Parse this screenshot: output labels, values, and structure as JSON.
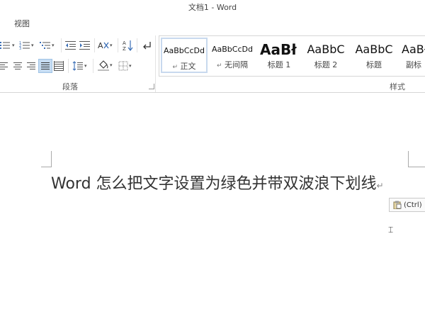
{
  "window": {
    "title": "文档1 - Word"
  },
  "tabs": {
    "view_label": "视图"
  },
  "ribbon": {
    "paragraph_group_label": "段落",
    "styles_group_label": "样式",
    "styles": [
      {
        "preview": "AaBbCcDd",
        "name": "正文",
        "mark": "↵",
        "active": true
      },
      {
        "preview": "AaBbCcDd",
        "name": "无间隔",
        "mark": "↵",
        "active": false
      },
      {
        "preview": "AaBł",
        "name": "标题 1",
        "mark": "",
        "active": false
      },
      {
        "preview": "AaBbC",
        "name": "标题 2",
        "mark": "",
        "active": false
      },
      {
        "preview": "AaBbC",
        "name": "标题",
        "mark": "",
        "active": false
      },
      {
        "preview": "AaBł",
        "name": "副标",
        "mark": "",
        "active": false
      }
    ],
    "icons": [
      "bullets-icon",
      "numbering-icon",
      "multilevel-list-icon",
      "decrease-indent-icon",
      "increase-indent-icon",
      "chinese-layout-icon",
      "sort-icon",
      "show-marks-icon",
      "align-left-icon",
      "align-center-icon",
      "align-right-icon",
      "justify-icon",
      "distributed-icon",
      "line-spacing-icon",
      "shading-icon",
      "borders-icon"
    ]
  },
  "document": {
    "text": "Word  怎么把文字设置为绿色并带双波浪下划线",
    "paragraph_mark": "↵"
  },
  "paste_options": {
    "label": "(Ctrl)"
  }
}
